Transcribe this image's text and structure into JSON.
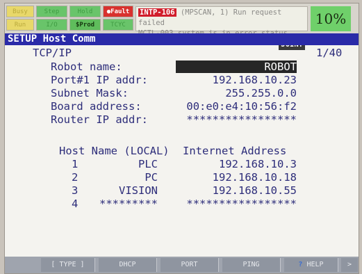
{
  "status_leds": {
    "busy": "Busy",
    "step": "Step",
    "hold": "Hold",
    "fault": "Fault",
    "run": "Run",
    "io": "I/O",
    "prod": "Prod",
    "tcyc": "TCYC"
  },
  "alarm": {
    "code": "INTP-106",
    "line1_text": " (MPSCAN, 1) Run request failed",
    "line2_text": "MCTL-003 system is in error status",
    "join_label": "JOINT"
  },
  "override_percent": "10%",
  "title": "SETUP Host Comm",
  "protocol": "TCP/IP",
  "page_indicator": "1/40",
  "fields": {
    "robot_name_label": "Robot name:",
    "robot_name_value": "ROBOT",
    "port_ip_label": "Port#1 IP addr:",
    "port_ip_value": "192.168.10.23",
    "subnet_label": "Subnet Mask:",
    "subnet_value": "255.255.0.0",
    "board_label": "Board address:",
    "board_value": "00:e0:e4:10:56:f2",
    "router_label": "Router IP addr:",
    "router_value": "*****************"
  },
  "host_table": {
    "header_name": "Host Name (LOCAL)",
    "header_addr": "Internet Address",
    "rows": [
      {
        "num": "1",
        "name": "PLC",
        "addr": "192.168.10.3"
      },
      {
        "num": "2",
        "name": "PC",
        "addr": "192.168.10.18"
      },
      {
        "num": "3",
        "name": "VISION",
        "addr": "192.168.10.55"
      },
      {
        "num": "4",
        "name": "*********",
        "addr": "*****************"
      }
    ]
  },
  "function_keys": {
    "f1": "[ TYPE ]",
    "f2": "DHCP",
    "f3": "PORT",
    "f4": "PING",
    "f5": "HELP",
    "next": ">"
  },
  "colors": {
    "title_bar": "#2a2aa8",
    "text": "#2d2d7a",
    "fault": "#d8312e",
    "override": "#6fd06a"
  }
}
